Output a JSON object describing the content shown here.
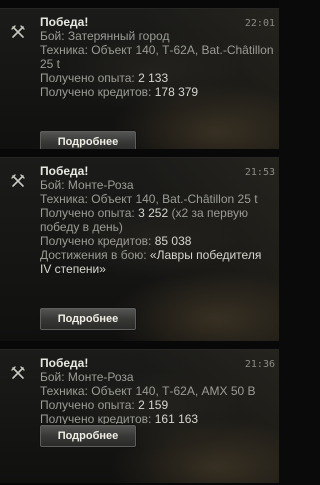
{
  "notifications": [
    {
      "time": "22:01",
      "icon": "crossed-swords-icon",
      "title": "Победа!",
      "battle_label": "Бой: ",
      "battle_value": "Затерянный город",
      "vehicles_label": "Техника: ",
      "vehicles_value": "Объект 140, Т-62А, Bat.-Châtillon 25 t",
      "xp_label": "Получено опыта: ",
      "xp_value": "2 133",
      "credits_label": "Получено кредитов: ",
      "credits_value": "178 379",
      "button_label": "Подробнее"
    },
    {
      "time": "21:53",
      "icon": "crossed-swords-icon",
      "title": "Победа!",
      "battle_label": "Бой: ",
      "battle_value": "Монте-Роза",
      "vehicles_label": "Техника: ",
      "vehicles_value": "Объект 140, Bat.-Châtillon 25 t",
      "xp_label": "Получено опыта: ",
      "xp_value": "3 252",
      "xp_note": "(x2 за первую победу в день)",
      "credits_label": "Получено кредитов: ",
      "credits_value": "85 038",
      "achievements_label": "Достижения в бою: ",
      "achievements_value": "«Лавры победителя IV степени»",
      "button_label": "Подробнее"
    },
    {
      "time": "21:36",
      "icon": "crossed-swords-icon",
      "title": "Победа!",
      "battle_label": "Бой: ",
      "battle_value": "Монте-Роза",
      "vehicles_label": "Техника: ",
      "vehicles_value": "Объект 140, Т-62А, AMX 50 B",
      "xp_label": "Получено опыта: ",
      "xp_value": "2 159",
      "credits_label": "Получено кредитов: ",
      "credits_value": "161 163",
      "button_label": "Подробнее"
    }
  ]
}
